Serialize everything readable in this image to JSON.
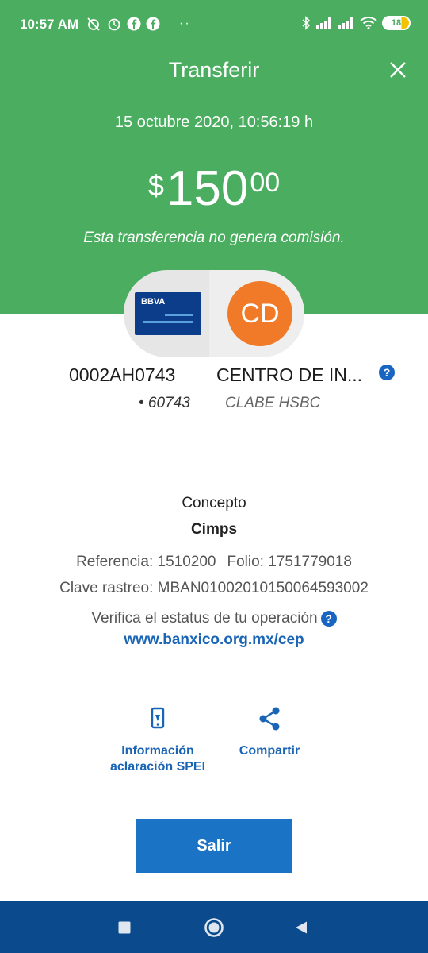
{
  "status_bar": {
    "time": "10:57 AM",
    "dots": "··",
    "battery": "18"
  },
  "header": {
    "title": "Transferir",
    "date": "15 octubre 2020, 10:56:19 h",
    "amount": {
      "currency": "$",
      "integer": "150",
      "decimals": "00"
    },
    "note": "Esta transferencia no genera comisión."
  },
  "account": {
    "bank_logo": "BBVA",
    "avatar_initials": "CD",
    "account_number": "0002AH0743",
    "name": "CENTRO DE IN...",
    "last_digits": "• 60743",
    "clabe_bank": "CLABE HSBC",
    "help": "?"
  },
  "details": {
    "concept_label": "Concepto",
    "concept_value": "Cimps",
    "reference": "Referencia: 1510200",
    "folio": "Folio: 1751779018",
    "trace": "Clave rastreo: MBAN01002010150064593002",
    "verify_text": "Verifica el estatus de tu operación",
    "verify_help": "?",
    "verify_link": "www.banxico.org.mx/cep"
  },
  "actions": {
    "info_line1": "Información",
    "info_line2": "aclaración SPEI",
    "share": "Compartir"
  },
  "exit_button": "Salir",
  "colors": {
    "header_green": "#4aad5f",
    "link_blue": "#1a64b5",
    "button_blue": "#1a73c4",
    "nav_blue": "#0b4a8c",
    "avatar_orange": "#f07a27",
    "bbva_navy": "#0c3d8a"
  },
  "icons": {
    "close": "close-icon",
    "info": "phone-info-icon",
    "share": "share-icon",
    "nav_recents": "square-icon",
    "nav_home": "circle-icon",
    "nav_back": "triangle-back-icon"
  }
}
